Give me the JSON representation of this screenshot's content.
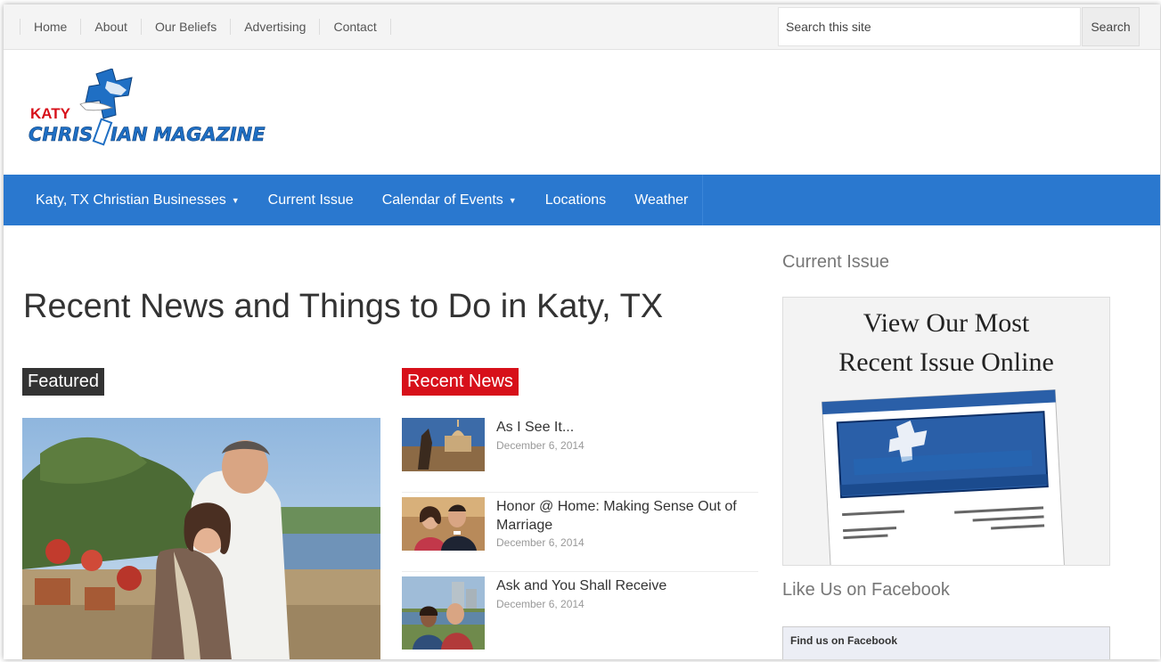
{
  "topnav": {
    "links": [
      "Home",
      "About",
      "Our Beliefs",
      "Advertising",
      "Contact"
    ]
  },
  "search": {
    "placeholder": "Search this site",
    "button": "Search"
  },
  "logo": {
    "line1": "KATY",
    "line2": "CHRIS",
    "line2b": "IAN",
    "line3": "MAGAZINE"
  },
  "mainnav": {
    "items": [
      {
        "label": "Katy, TX Christian Businesses",
        "dropdown": true
      },
      {
        "label": "Current Issue",
        "dropdown": false
      },
      {
        "label": "Calendar of Events",
        "dropdown": true
      },
      {
        "label": "Locations",
        "dropdown": false
      },
      {
        "label": "Weather",
        "dropdown": false
      }
    ],
    "caret": "▼"
  },
  "main": {
    "title": "Recent News and Things to Do in Katy, TX",
    "featured_label": "Featured",
    "recent_label": "Recent News",
    "news": [
      {
        "title": "As I See It...",
        "date": "December 6, 2014"
      },
      {
        "title": "Honor @ Home: Making Sense Out of Marriage",
        "date": "December 6, 2014"
      },
      {
        "title": "Ask and You Shall Receive",
        "date": "December 6, 2014"
      }
    ]
  },
  "sidebar": {
    "current_issue_heading": "Current Issue",
    "issue_line1": "View Our Most",
    "issue_line2": "Recent Issue Online",
    "facebook_heading": "Like Us on Facebook",
    "facebook_box_title": "Find us on Facebook"
  },
  "colors": {
    "nav": "#2a78cf",
    "recent": "#d7101a",
    "featured": "#333333"
  }
}
